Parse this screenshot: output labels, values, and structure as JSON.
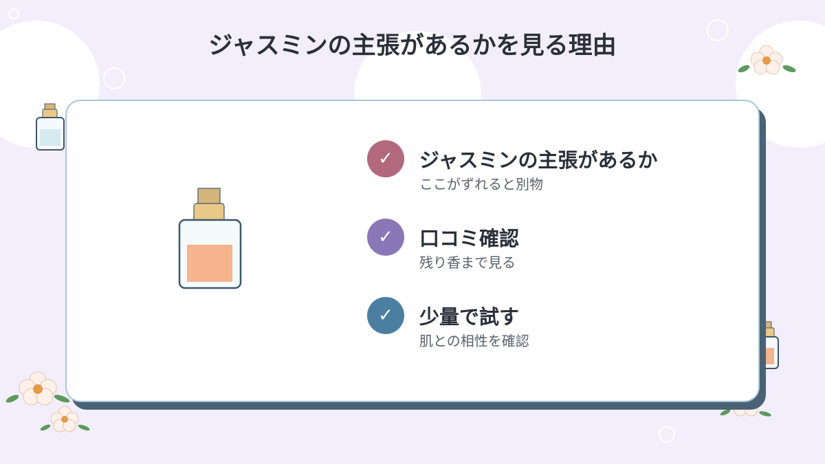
{
  "title": "ジャスミンの主張があるかを見る理由",
  "items": [
    {
      "title": "ジャスミンの主張があるか",
      "subtitle": "ここがずれると別物",
      "check": "✓",
      "color": "#b2697d"
    },
    {
      "title": "口コミ確認",
      "subtitle": "残り香まで見る",
      "check": "✓",
      "color": "#8a77b8"
    },
    {
      "title": "少量で試す",
      "subtitle": "肌との相性を確認",
      "check": "✓",
      "color": "#4a7fa2"
    }
  ],
  "colors": {
    "background": "#f2eefb",
    "card_shadow": "#4a6275",
    "perfume_liquid": "#f5b38e",
    "bottle_cap": "#e9c987"
  },
  "icons": [
    "perfume-bottle-icon",
    "flower-icon",
    "check-icon"
  ]
}
